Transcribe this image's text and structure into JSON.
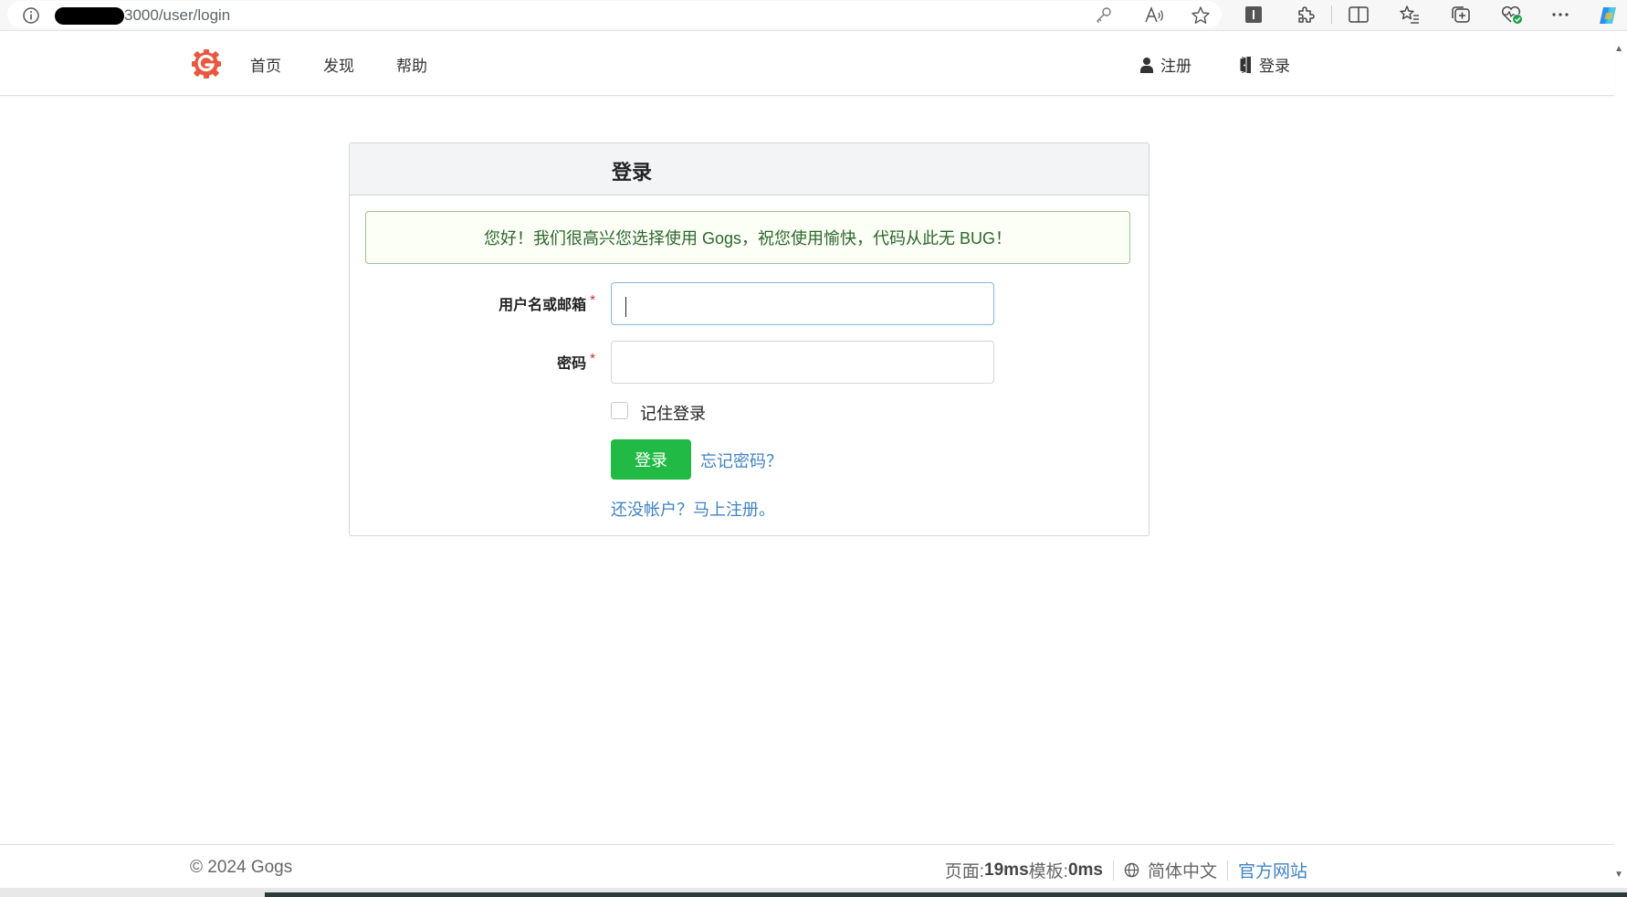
{
  "browser": {
    "url_suffix": "3000/user/login"
  },
  "header": {
    "nav": [
      {
        "label": "首页"
      },
      {
        "label": "发现"
      },
      {
        "label": "帮助"
      }
    ],
    "register_label": "注册",
    "login_label": "登录"
  },
  "login_form": {
    "title": "登录",
    "welcome_message": "您好！我们很高兴您选择使用 Gogs，祝您使用愉快，代码从此无 BUG！",
    "username_label": "用户名或邮箱",
    "password_label": "密码",
    "required_mark": "*",
    "username_value": "",
    "password_value": "",
    "remember_label": "记住登录",
    "submit_label": "登录",
    "forgot_password": "忘记密码？",
    "signup_prompt": "还没帐户？马上注册。"
  },
  "footer": {
    "copyright": "© 2024 Gogs",
    "page_label": "页面: ",
    "page_time": "19ms",
    "template_label": " 模板: ",
    "template_time": "0ms",
    "language": "简体中文",
    "official_site": "官方网站"
  },
  "colors": {
    "primary_green": "#21ba45",
    "link_blue": "#4183c4",
    "logo_orange": "#e8573f",
    "message_green": "#2c662d",
    "required_red": "#db2828"
  }
}
